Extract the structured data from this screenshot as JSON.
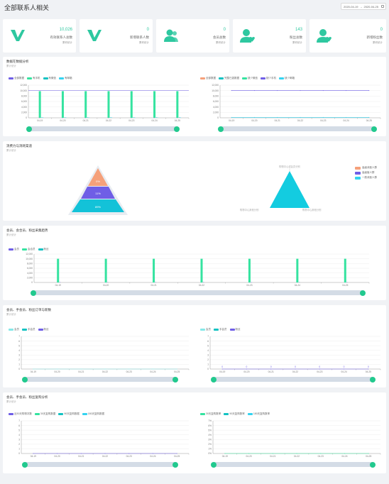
{
  "header": {
    "title": "全部联系人相关",
    "date_from": "2020-04-19",
    "date_sep": "→",
    "date_to": "2020-04-25"
  },
  "kpis": [
    {
      "value": "10,026",
      "label": "有效联系人总数",
      "sub": "累积统计",
      "icon": "v-logo-icon"
    },
    {
      "value": "0",
      "label": "新增联系人数",
      "sub": "累积统计",
      "icon": "v-logo-icon"
    },
    {
      "value": "0",
      "label": "会员总数",
      "sub": "累积统计",
      "icon": "users-icon"
    },
    {
      "value": "143",
      "label": "粉丝总数",
      "sub": "累积统计",
      "icon": "user-heart-icon"
    },
    {
      "value": "0",
      "label": "新增粉丝数",
      "sub": "累积统计",
      "icon": "user-heart-icon"
    }
  ],
  "colors": {
    "accent": "#2ec8a0",
    "teal": "#13c2c2",
    "purple": "#6f5ee6",
    "cyan": "#34d3f0",
    "green": "#35e3a0",
    "orange": "#f5a07a",
    "pink": "#f9c1b1",
    "handle": "#22c98e"
  },
  "p1": {
    "title": "数据在数据分析",
    "sub": "累计统计",
    "left_legend": [
      "全部数据",
      "有手机",
      "有微信",
      "有邮箱"
    ],
    "right_legend": [
      "全部数据",
      "完整已激数据",
      "缺少微信",
      "缺少手机",
      "缺少邮箱"
    ]
  },
  "p2": {
    "title": "消费力与消耗渠道",
    "sub": "累计统计",
    "funnel_labels": [
      "0%",
      "11%",
      "89%"
    ],
    "tri_labels": [
      "购物中心或会员分别",
      "购物中心其他分别",
      "购物中心其他分别"
    ],
    "legend": [
      "高级消费人群",
      "高级客人群",
      "一般消费人群"
    ]
  },
  "p3": {
    "title": "会员、会合员、粉丝采集趋势",
    "sub": "累计统计",
    "legend": [
      "会员",
      "会合员",
      "粉丝"
    ]
  },
  "p4": {
    "title": "会员、手会员、粉丝订单与新数",
    "sub": "累计统计",
    "legend": [
      "会员",
      "手会员",
      "粉丝"
    ]
  },
  "p5": {
    "title": "会员、手会员、粉丝复购分析",
    "sub": "累计统计",
    "left_legend": [
      "近30天购物次数",
      "30天复购数据",
      "90天复购数据",
      "180天复购数据"
    ],
    "right_legend": [
      "30天复购数率",
      "90天复购数率",
      "180天复购数率"
    ]
  },
  "chart_data": [
    {
      "type": "bar",
      "categories": [
        "04-19",
        "04-20",
        "04-21",
        "04-22",
        "04-23",
        "04-24",
        "04-25"
      ],
      "series": [
        {
          "name": "全部数据",
          "values": [
            0,
            0,
            0,
            0,
            0,
            0,
            0
          ]
        },
        {
          "name": "有手机",
          "values": [
            9800,
            9800,
            9800,
            9800,
            9800,
            9800,
            9800
          ]
        },
        {
          "name": "有微信",
          "values": [
            150,
            150,
            150,
            150,
            150,
            150,
            150
          ]
        },
        {
          "name": "有邮箱",
          "values": [
            150,
            150,
            150,
            150,
            150,
            150,
            150
          ]
        }
      ],
      "line_value": 10026,
      "ylim": [
        0,
        12000
      ],
      "yticks": [
        "0",
        "2,000",
        "4,000",
        "6,000",
        "8,000",
        "10,000",
        "12,000"
      ]
    },
    {
      "type": "line",
      "categories": [
        "04-19",
        "04-20",
        "04-21",
        "04-22",
        "04-23",
        "04-24",
        "04-25"
      ],
      "series": [
        {
          "name": "全部数据",
          "values": [
            10026,
            10026,
            10026,
            10026,
            10026,
            10026,
            10026
          ]
        },
        {
          "name": "缺少邮箱",
          "values": [
            150,
            150,
            150,
            150,
            150,
            150,
            150
          ]
        }
      ],
      "ylim": [
        0,
        12000
      ],
      "yticks": [
        "0",
        "2,000",
        "4,000",
        "6,000",
        "8,000",
        "10,000",
        "12,000"
      ]
    },
    {
      "type": "bar",
      "categories": [
        "04-19",
        "04-20",
        "04-21",
        "04-22",
        "04-23",
        "04-24",
        "04-25"
      ],
      "series": [
        {
          "name": "会员",
          "values": [
            0,
            0,
            0,
            0,
            0,
            0,
            0
          ]
        },
        {
          "name": "会合员",
          "values": [
            10026,
            10026,
            10026,
            10026,
            10026,
            10026,
            10026
          ]
        },
        {
          "name": "粉丝",
          "values": [
            143,
            143,
            143,
            143,
            143,
            143,
            143
          ]
        }
      ],
      "ylim": [
        0,
        12000
      ],
      "yticks": [
        "0",
        "2,000",
        "4,000",
        "6,000",
        "8,000",
        "10,000",
        "12,000"
      ]
    },
    {
      "type": "line",
      "categories": [
        "04-19",
        "04-20",
        "04-21",
        "04-22",
        "04-23",
        "04-24",
        "04-25"
      ],
      "series": [
        {
          "name": "会员",
          "values": [
            0,
            0,
            0,
            0,
            0,
            0,
            0
          ]
        }
      ],
      "ylim": [
        0,
        7
      ],
      "yticks": [
        "0",
        "1",
        "2",
        "3",
        "4",
        "5",
        "6",
        "7"
      ]
    },
    {
      "type": "line",
      "categories": [
        "04-19",
        "04-20",
        "04-21",
        "04-22",
        "04-23",
        "04-24",
        "04-25"
      ],
      "series": [
        {
          "name": "粉丝",
          "values": [
            0,
            0,
            0,
            0,
            0,
            0,
            0
          ]
        }
      ],
      "ylim": [
        0,
        7
      ],
      "yticks": [
        "0",
        "1",
        "2",
        "3",
        "4",
        "5",
        "6",
        "7"
      ],
      "point_labels": [
        "0",
        "0",
        "0",
        "0",
        "0",
        "0",
        "0"
      ]
    },
    {
      "type": "line",
      "categories": [
        "04-19",
        "04-20",
        "04-21",
        "04-22",
        "04-23",
        "04-24",
        "04-25"
      ],
      "series": [
        {
          "name": "近30天购物次数",
          "values": [
            0,
            0,
            0,
            0,
            0,
            0,
            0
          ]
        }
      ],
      "ylim": [
        0,
        7
      ],
      "yticks": [
        "0",
        "1",
        "2",
        "3",
        "4",
        "5",
        "6",
        "7"
      ]
    },
    {
      "type": "line",
      "categories": [
        "04-19",
        "04-20",
        "04-21",
        "04-22",
        "04-23",
        "04-24",
        "04-25"
      ],
      "series": [
        {
          "name": "30天复购数率",
          "values": [
            0,
            0,
            0,
            0,
            0,
            0,
            0
          ]
        }
      ],
      "ylim": [
        0,
        7
      ],
      "yticks": [
        "0%",
        "1%",
        "2%",
        "3%",
        "4%",
        "5%",
        "6%",
        "7%"
      ]
    }
  ]
}
